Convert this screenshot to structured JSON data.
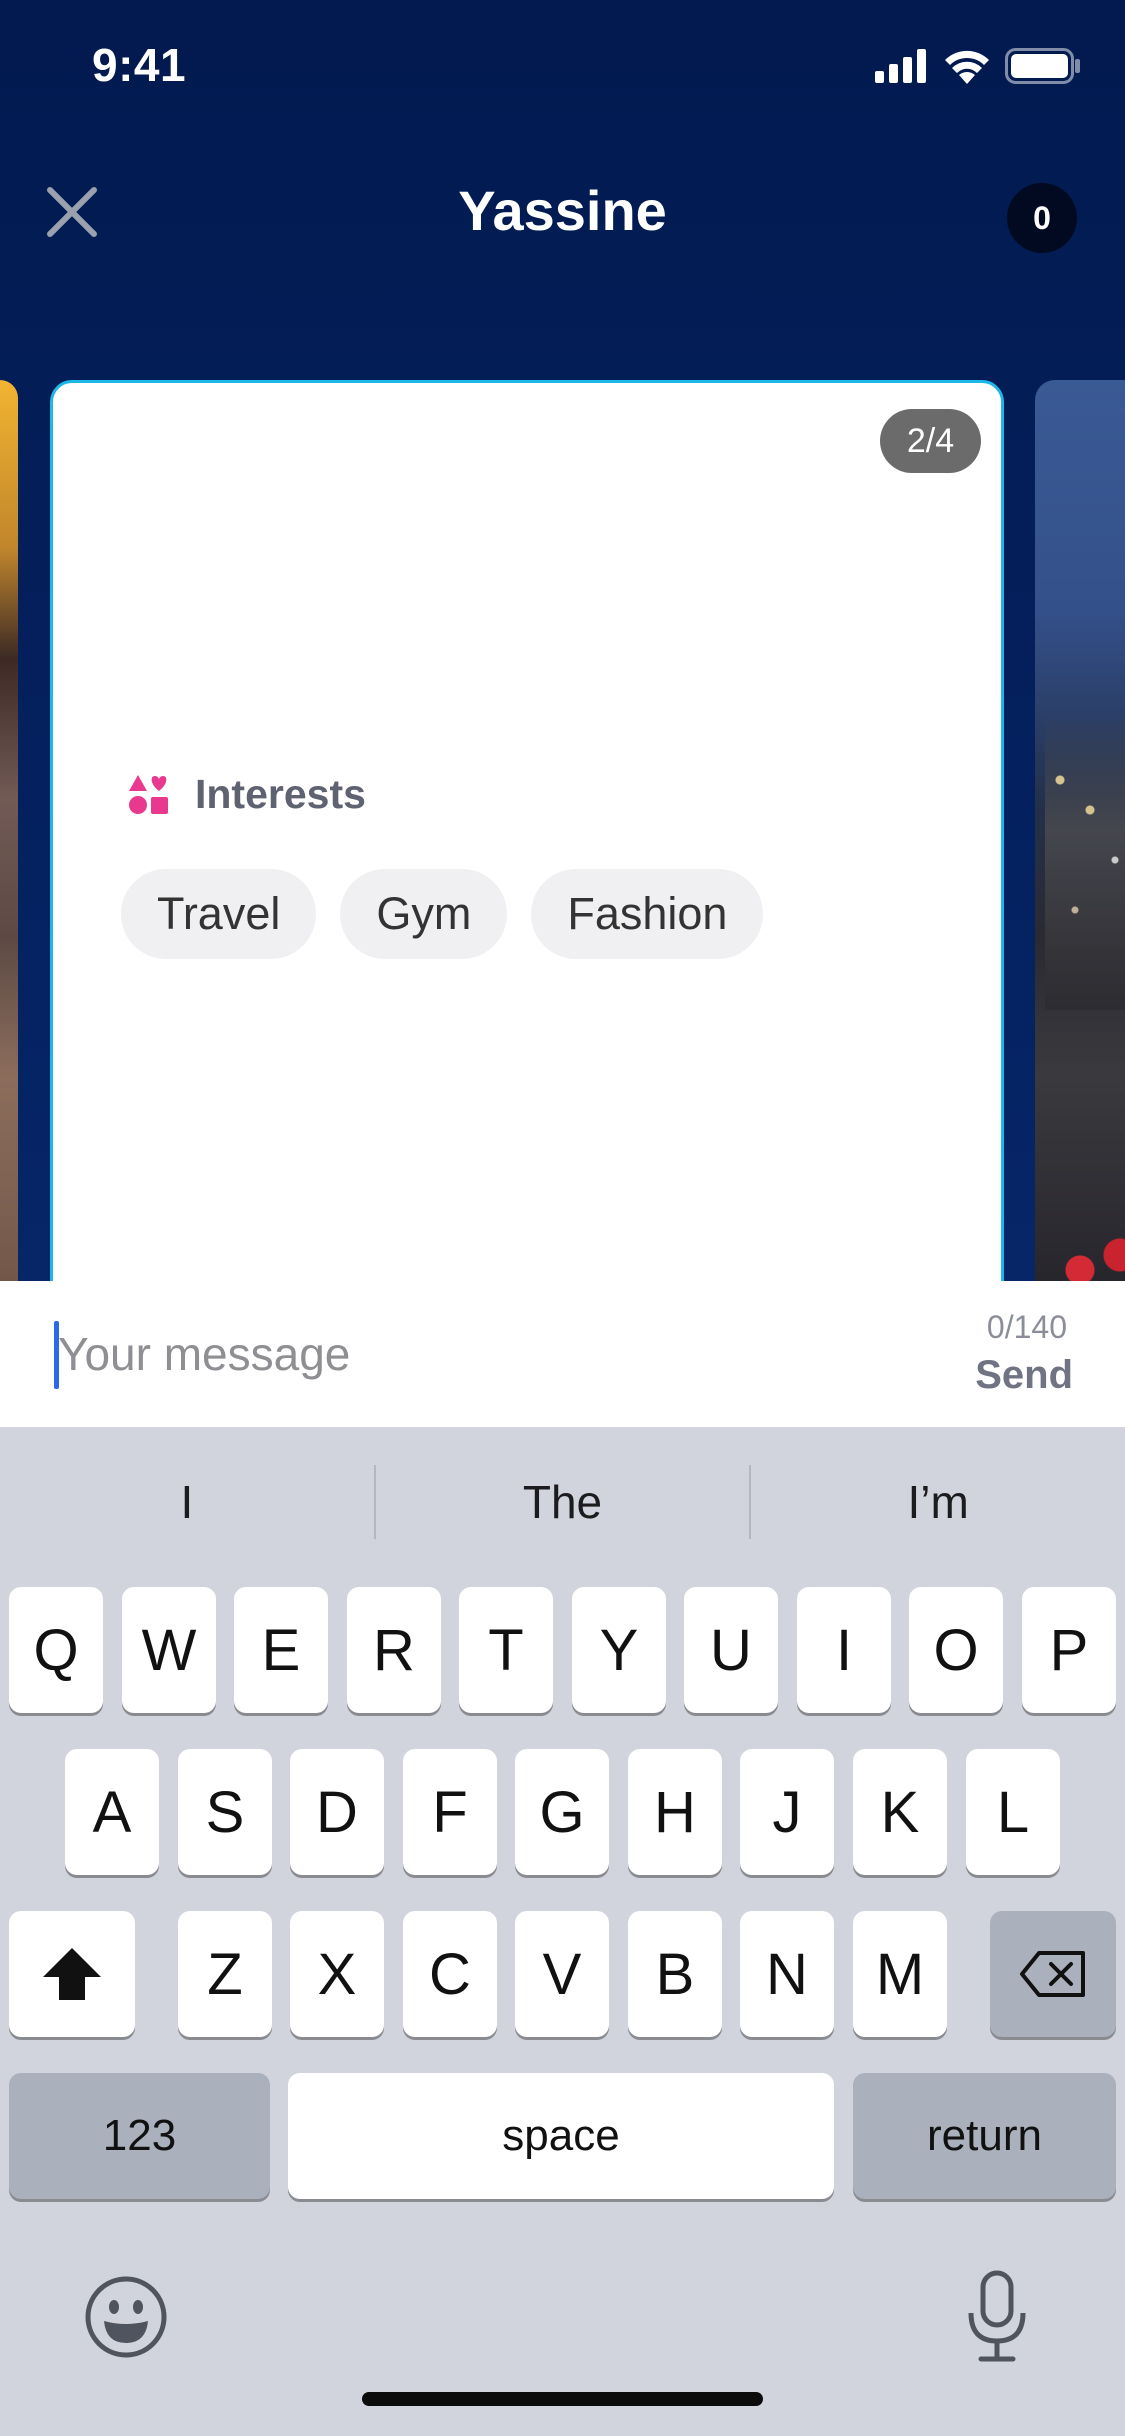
{
  "status_bar": {
    "time": "9:41",
    "icons": [
      "cellular-signal-icon",
      "wifi-icon",
      "battery-icon"
    ]
  },
  "header": {
    "title": "Yassine",
    "counter": "0",
    "close_icon": "close-icon"
  },
  "card": {
    "page_indicator": "2/4",
    "section_icon": "interests-icon",
    "section_title": "Interests",
    "interests": [
      "Travel",
      "Gym",
      "Fashion"
    ]
  },
  "message": {
    "placeholder": "Your message",
    "char_count": "0/140",
    "send_label": "Send"
  },
  "keyboard": {
    "suggestions": [
      "I",
      "The",
      "I’m"
    ],
    "row1": [
      "Q",
      "W",
      "E",
      "R",
      "T",
      "Y",
      "U",
      "I",
      "O",
      "P"
    ],
    "row2": [
      "A",
      "S",
      "D",
      "F",
      "G",
      "H",
      "J",
      "K",
      "L"
    ],
    "row3": [
      "Z",
      "X",
      "C",
      "V",
      "B",
      "N",
      "M"
    ],
    "numbers_label": "123",
    "space_label": "space",
    "return_label": "return"
  },
  "colors": {
    "header_bg": "#031c5a",
    "card_border": "#1fb6e8",
    "interests_icon": "#e8398f",
    "cursor": "#2a6ae8"
  }
}
